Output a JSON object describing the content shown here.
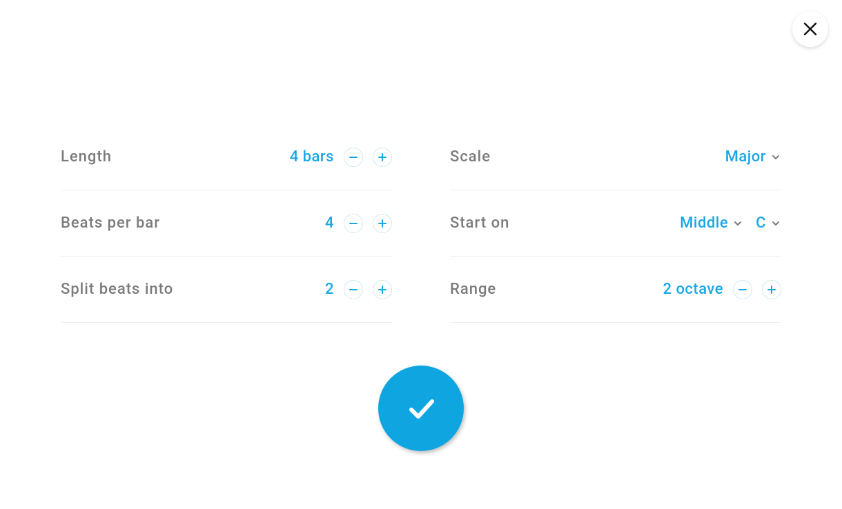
{
  "settings": {
    "length": {
      "label": "Length",
      "value": "4 bars"
    },
    "bpb": {
      "label": "Beats per bar",
      "value": "4"
    },
    "split": {
      "label": "Split beats into",
      "value": "2"
    },
    "scale": {
      "label": "Scale",
      "value": "Major"
    },
    "start": {
      "label": "Start on",
      "octave": "Middle",
      "note": "C"
    },
    "range": {
      "label": "Range",
      "value": "2 octave"
    }
  },
  "colors": {
    "accent": "#1aa7e5",
    "labelGray": "#7b7b7b",
    "confirmBg": "#0ea5e0"
  }
}
